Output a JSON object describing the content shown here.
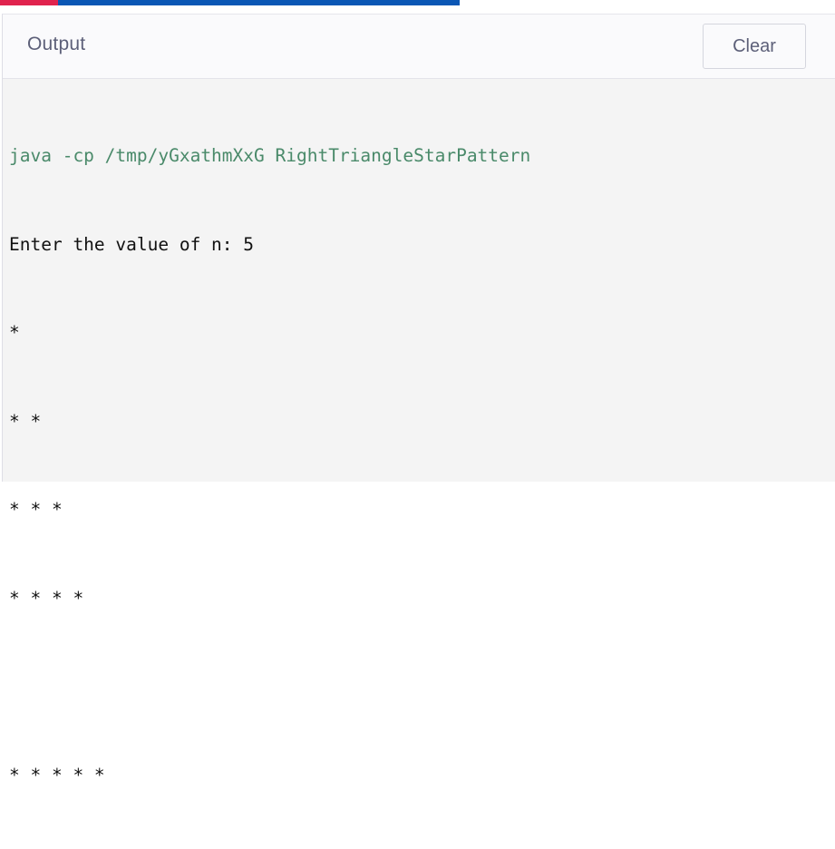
{
  "header": {
    "title": "Output",
    "clear_label": "Clear"
  },
  "console": {
    "command": "java -cp /tmp/yGxathmXxG RightTriangleStarPattern",
    "lines": [
      "Enter the value of n: 5",
      "*",
      "* *",
      "* * *",
      "* * * *",
      "",
      "* * * * *"
    ]
  },
  "colors": {
    "accent_red": "#e0234e",
    "accent_blue": "#0b57b5",
    "command_text": "#4a8a6a"
  }
}
